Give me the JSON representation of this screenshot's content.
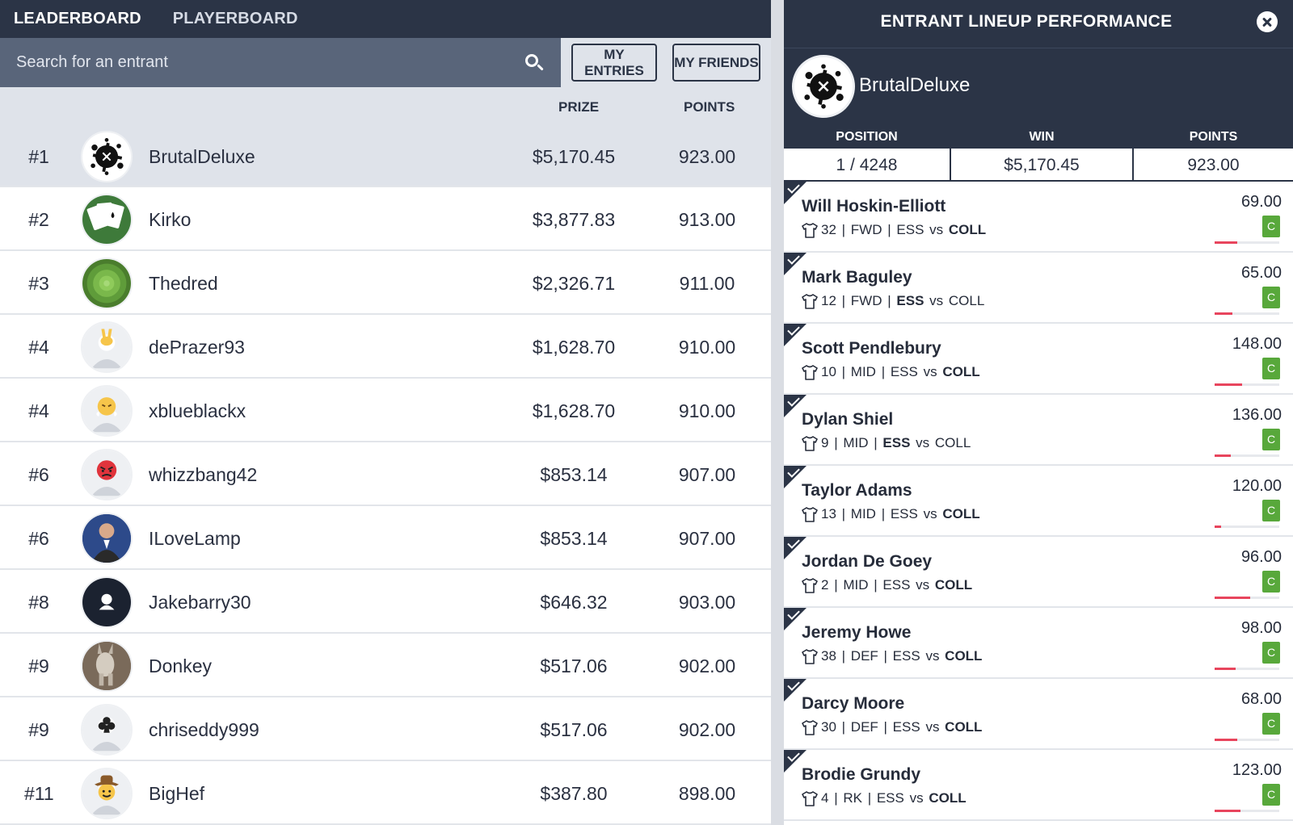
{
  "nav": {
    "tabs": [
      "LEADERBOARD",
      "PLAYERBOARD"
    ]
  },
  "search": {
    "placeholder": "Search for an entrant"
  },
  "filters": {
    "my_entries": "MY ENTRIES",
    "my_friends": "MY FRIENDS"
  },
  "columns": {
    "prize": "PRIZE",
    "points": "POINTS"
  },
  "leaderboard": [
    {
      "rank": "#1",
      "name": "BrutalDeluxe",
      "prize": "$5,170.45",
      "points": "923.00",
      "avatar": "splatter-x"
    },
    {
      "rank": "#2",
      "name": "Kirko",
      "prize": "$3,877.83",
      "points": "913.00",
      "avatar": "playing-cards"
    },
    {
      "rank": "#3",
      "name": "Thedred",
      "prize": "$2,326.71",
      "points": "911.00",
      "avatar": "succulent"
    },
    {
      "rank": "#4",
      "name": "dePrazer93",
      "prize": "$1,628.70",
      "points": "910.00",
      "avatar": "peace-hand"
    },
    {
      "rank": "#4",
      "name": "xblueblackx",
      "prize": "$1,628.70",
      "points": "910.00",
      "avatar": "steaming-face"
    },
    {
      "rank": "#6",
      "name": "whizzbang42",
      "prize": "$853.14",
      "points": "907.00",
      "avatar": "angry-face"
    },
    {
      "rank": "#6",
      "name": "ILoveLamp",
      "prize": "$853.14",
      "points": "907.00",
      "avatar": "photo-man"
    },
    {
      "rank": "#8",
      "name": "Jakebarry30",
      "prize": "$646.32",
      "points": "903.00",
      "avatar": "default-person"
    },
    {
      "rank": "#9",
      "name": "Donkey",
      "prize": "$517.06",
      "points": "902.00",
      "avatar": "donkey"
    },
    {
      "rank": "#9",
      "name": "chriseddy999",
      "prize": "$517.06",
      "points": "902.00",
      "avatar": "club-suit"
    },
    {
      "rank": "#11",
      "name": "BigHef",
      "prize": "$387.80",
      "points": "898.00",
      "avatar": "cowboy-face"
    }
  ],
  "panel": {
    "title": "ENTRANT LINEUP PERFORMANCE",
    "entrant": "BrutalDeluxe",
    "stats": {
      "position_label": "POSITION",
      "position": "1 / 4248",
      "win_label": "WIN",
      "win": "$5,170.45",
      "points_label": "POINTS",
      "points": "923.00"
    },
    "players": [
      {
        "name": "Will Hoskin-Elliott",
        "number": "32",
        "pos": "FWD",
        "home": "ESS",
        "vs": "vs",
        "away": "COLL",
        "bold_team": "away",
        "points": "69.00",
        "badge": "C",
        "progress": 0.35
      },
      {
        "name": "Mark Baguley",
        "number": "12",
        "pos": "FWD",
        "home": "ESS",
        "vs": "vs",
        "away": "COLL",
        "bold_team": "home",
        "points": "65.00",
        "badge": "C",
        "progress": 0.27
      },
      {
        "name": "Scott Pendlebury",
        "number": "10",
        "pos": "MID",
        "home": "ESS",
        "vs": "vs",
        "away": "COLL",
        "bold_team": "away",
        "points": "148.00",
        "badge": "C",
        "progress": 0.42
      },
      {
        "name": "Dylan Shiel",
        "number": "9",
        "pos": "MID",
        "home": "ESS",
        "vs": "vs",
        "away": "COLL",
        "bold_team": "home",
        "points": "136.00",
        "badge": "C",
        "progress": 0.25
      },
      {
        "name": "Taylor Adams",
        "number": "13",
        "pos": "MID",
        "home": "ESS",
        "vs": "vs",
        "away": "COLL",
        "bold_team": "away",
        "points": "120.00",
        "badge": "C",
        "progress": 0.1
      },
      {
        "name": "Jordan De Goey",
        "number": "2",
        "pos": "MID",
        "home": "ESS",
        "vs": "vs",
        "away": "COLL",
        "bold_team": "away",
        "points": "96.00",
        "badge": "C",
        "progress": 0.55
      },
      {
        "name": "Jeremy Howe",
        "number": "38",
        "pos": "DEF",
        "home": "ESS",
        "vs": "vs",
        "away": "COLL",
        "bold_team": "away",
        "points": "98.00",
        "badge": "C",
        "progress": 0.32
      },
      {
        "name": "Darcy Moore",
        "number": "30",
        "pos": "DEF",
        "home": "ESS",
        "vs": "vs",
        "away": "COLL",
        "bold_team": "away",
        "points": "68.00",
        "badge": "C",
        "progress": 0.35
      },
      {
        "name": "Brodie Grundy",
        "number": "4",
        "pos": "RK",
        "home": "ESS",
        "vs": "vs",
        "away": "COLL",
        "bold_team": "away",
        "points": "123.00",
        "badge": "C",
        "progress": 0.4
      }
    ]
  },
  "colors": {
    "navy": "#2b3446",
    "search_bg": "#59657a",
    "highlight_row": "#dfe3ea",
    "badge_green": "#58a83b",
    "progress_red": "#e8455d"
  }
}
